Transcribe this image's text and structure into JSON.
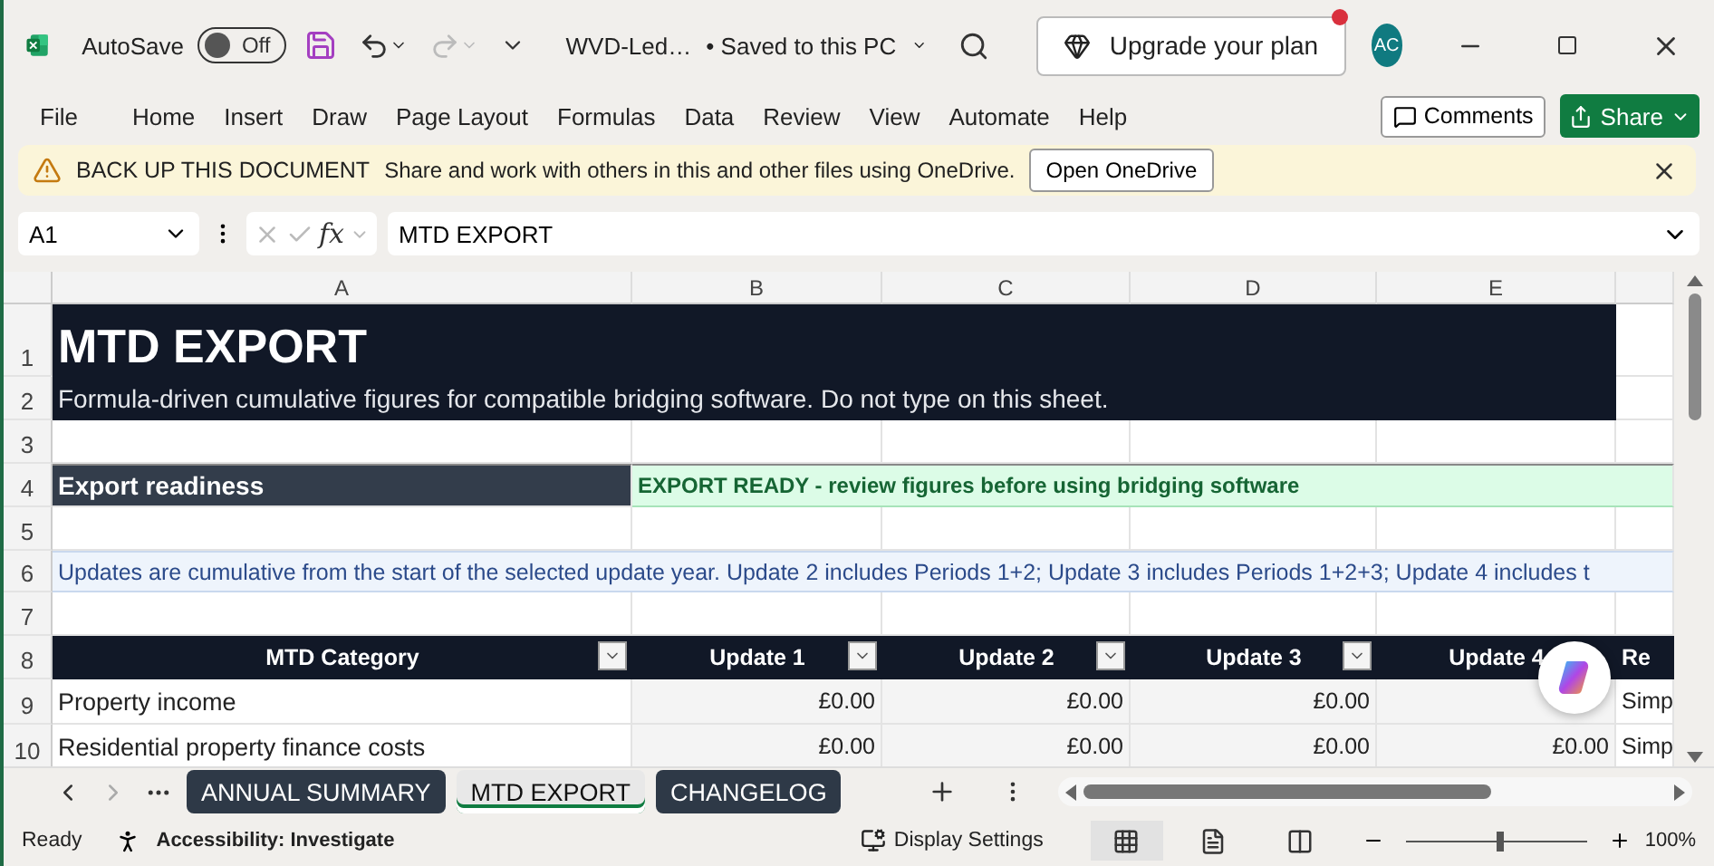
{
  "window": {
    "autosave_label": "AutoSave",
    "autosave": {
      "label": "Off",
      "on": false
    },
    "file_name": "WVD-Led…",
    "save_status": "• Saved to this PC",
    "upgrade": "Upgrade your plan",
    "avatar": "AC"
  },
  "menu": [
    {
      "label": "File"
    },
    {
      "label": "Home"
    },
    {
      "label": "Insert"
    },
    {
      "label": "Draw"
    },
    {
      "label": "Page Layout"
    },
    {
      "label": "Formulas"
    },
    {
      "label": "Data"
    },
    {
      "label": "Review"
    },
    {
      "label": "View"
    },
    {
      "label": "Automate"
    },
    {
      "label": "Help"
    }
  ],
  "comments": "Comments",
  "share": "Share",
  "notice": {
    "title": "BACK UP THIS DOCUMENT",
    "message": "Share and work with others in this and other files using OneDrive.",
    "button": "Open OneDrive"
  },
  "formula_bar": {
    "name_box": "A1",
    "function_label": "fx",
    "formula": "MTD EXPORT"
  },
  "sheet": {
    "columns": [
      "A",
      "B",
      "C",
      "D",
      "E"
    ],
    "rows": [
      {
        "number": "1",
        "kind": "title",
        "text": "MTD EXPORT"
      },
      {
        "number": "2",
        "kind": "subtitle",
        "text": "Formula-driven cumulative figures for compatible bridging software. Do not type on this sheet."
      },
      {
        "number": "3",
        "kind": "blank"
      },
      {
        "number": "4",
        "kind": "readiness",
        "label": "Export readiness",
        "status": "EXPORT READY - review figures before using bridging software"
      },
      {
        "number": "5",
        "kind": "blank"
      },
      {
        "number": "6",
        "kind": "note",
        "text": "Updates are cumulative from the start of the selected update year. Update 2 includes Periods 1+2; Update 3 includes Periods 1+2+3; Update 4 includes t"
      },
      {
        "number": "7",
        "kind": "blank"
      },
      {
        "number": "8",
        "kind": "header",
        "cells": [
          {
            "text": "MTD Category",
            "filter": true
          },
          {
            "text": "Update 1",
            "filter": true
          },
          {
            "text": "Update 2",
            "filter": true
          },
          {
            "text": "Update 3",
            "filter": true
          },
          {
            "text": "Update 4",
            "filter": false
          },
          {
            "text": "Re",
            "filter": false
          }
        ]
      },
      {
        "number": "9",
        "kind": "data",
        "cells": [
          "Property income",
          "£0.00",
          "£0.00",
          "£0.00",
          null,
          "Simp"
        ]
      },
      {
        "number": "10",
        "kind": "data",
        "cells": [
          "Residential property finance costs",
          "£0.00",
          "£0.00",
          "£0.00",
          "£0.00",
          "Simp"
        ]
      }
    ]
  },
  "sheet_tabs": [
    {
      "label": "ANNUAL SUMMARY",
      "selected": false
    },
    {
      "label": "MTD EXPORT",
      "selected": true
    },
    {
      "label": "CHANGELOG",
      "selected": false
    }
  ],
  "status_bar": {
    "status": "Ready",
    "accessibility": "Accessibility: Investigate",
    "display_settings": "Display Settings",
    "views": [
      {
        "kind": "normal",
        "selected": true
      },
      {
        "kind": "page_layout",
        "selected": false
      },
      {
        "kind": "page_break",
        "selected": false
      }
    ],
    "zoom": {
      "level": 0.52,
      "reading": "100%"
    }
  }
}
